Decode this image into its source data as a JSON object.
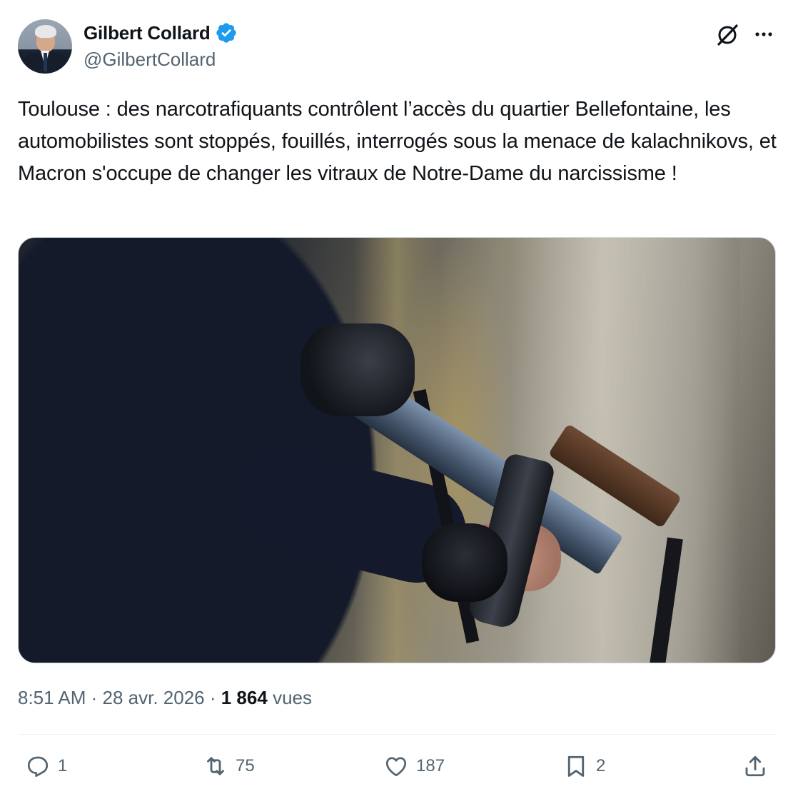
{
  "author": {
    "name": "Gilbert Collard",
    "handle": "@GilbertCollard",
    "verified_color": "#1d9bf0"
  },
  "header_icons": [
    "grok-icon",
    "more-icon"
  ],
  "tweet": {
    "text": "Toulouse : des narcotrafiquants contrôlent l’accès du quartier Bellefontaine, les automobilistes sont stoppés, fouillés, interrogés sous la menace de kalachnikovs, et Macron s'occupe de changer les vitraux de Notre-Dame du narcissisme !"
  },
  "meta": {
    "time": "8:51 AM",
    "separator": " · ",
    "date": "28 avr. 2026",
    "views_count": "1 864",
    "views_label": "vues"
  },
  "actions": {
    "reply_count": "1",
    "retweet_count": "75",
    "like_count": "187",
    "bookmark_count": "2"
  },
  "colors": {
    "text": "#0f1419",
    "secondary": "#536471",
    "divider": "#eff3f4",
    "accent": "#1d9bf0"
  }
}
